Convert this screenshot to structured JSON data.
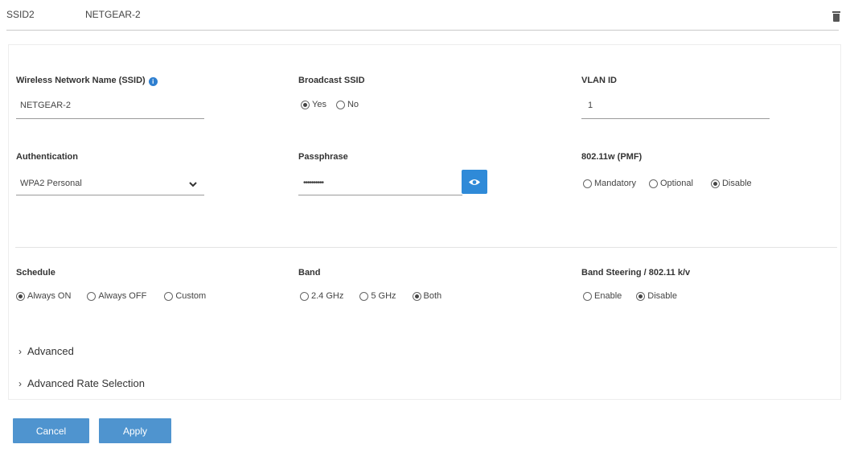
{
  "header": {
    "ssid_label": "SSID2",
    "ssid_name": "NETGEAR-2",
    "delete_icon": "trash-icon"
  },
  "ssid_field": {
    "label": "Wireless Network Name (SSID)",
    "info_icon": "info-icon",
    "value": "NETGEAR-2"
  },
  "broadcast": {
    "label": "Broadcast SSID",
    "options": [
      "Yes",
      "No"
    ],
    "selected": "Yes"
  },
  "vlan": {
    "label": "VLAN ID",
    "value": "1"
  },
  "authentication": {
    "label": "Authentication",
    "value": "WPA2 Personal"
  },
  "passphrase": {
    "label": "Passphrase",
    "value": "••••••••••",
    "reveal_icon": "eye-icon"
  },
  "pmf": {
    "label": "802.11w (PMF)",
    "options": [
      "Mandatory",
      "Optional",
      "Disable"
    ],
    "selected": "Disable"
  },
  "schedule": {
    "label": "Schedule",
    "options": [
      "Always ON",
      "Always OFF",
      "Custom"
    ],
    "selected": "Always ON"
  },
  "band": {
    "label": "Band",
    "options": [
      "2.4 GHz",
      "5 GHz",
      "Both"
    ],
    "selected": "Both"
  },
  "band_steering": {
    "label": "Band Steering / 802.11 k/v",
    "options": [
      "Enable",
      "Disable"
    ],
    "selected": "Disable"
  },
  "sections": {
    "advanced": "Advanced",
    "advanced_rate": "Advanced Rate Selection"
  },
  "buttons": {
    "cancel": "Cancel",
    "apply": "Apply"
  },
  "colors": {
    "accent": "#2f8ad8",
    "button": "#4f94cf"
  }
}
